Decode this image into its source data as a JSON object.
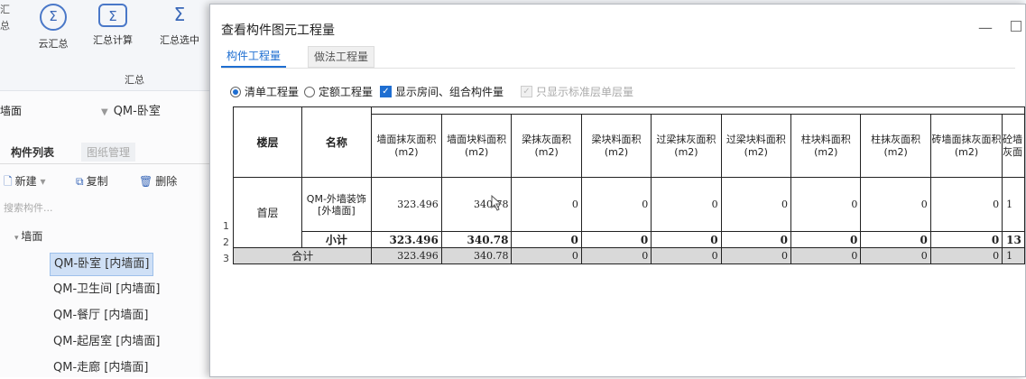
{
  "app": {
    "ribbon_left_partial": [
      "汇",
      "总"
    ],
    "buttons": [
      {
        "label": "云汇总",
        "icon": "Σ"
      },
      {
        "label": "汇总计算",
        "icon": "Σ"
      },
      {
        "label": "汇总选中",
        "icon": "Σ"
      }
    ],
    "group_label": "汇总",
    "selector_left": "墙面",
    "selector_value": "QM-卧室",
    "panel_tabs": [
      "构件列表",
      "图纸管理"
    ],
    "toolbar": {
      "new": "新建",
      "copy": "复制",
      "delete": "删除"
    },
    "search_placeholder": "搜索构件...",
    "tree_root": "墙面",
    "tree_items": [
      {
        "label": "QM-卧室 [内墙面]",
        "selected": true
      },
      {
        "label": "QM-卫生间 [内墙面]",
        "selected": false
      },
      {
        "label": "QM-餐厅 [内墙面]",
        "selected": false
      },
      {
        "label": "QM-起居室 [内墙面]",
        "selected": false
      },
      {
        "label": "QM-走廊 [内墙面]",
        "selected": false
      }
    ]
  },
  "dialog": {
    "title": "查看构件图元工程量",
    "minimize": "—",
    "tabs": [
      {
        "label": "构件工程量",
        "active": true
      },
      {
        "label": "做法工程量",
        "active": false
      }
    ],
    "options": {
      "radio_qd": {
        "label": "清单工程量",
        "checked": true
      },
      "radio_de": {
        "label": "定额工程量",
        "checked": false
      },
      "check_rooms": {
        "label": "显示房间、组合构件量",
        "checked": true
      },
      "check_std": {
        "label": "只显示标准层单层量",
        "checked": true,
        "disabled": true
      }
    },
    "table": {
      "headers": {
        "floor": "楼层",
        "name": "名称",
        "columns": [
          "墙面抹灰面积(m2)",
          "墙面块料面积(m2)",
          "梁抹灰面积(m2)",
          "梁块料面积(m2)",
          "过梁抹灰面积(m2)",
          "过梁块料面积(m2)",
          "柱块料面积(m2)",
          "柱抹灰面积(m2)",
          "砖墙面抹灰面积(m2)",
          "砼墙灰面"
        ]
      },
      "rows": [
        {
          "rownum": "1",
          "floor": "首层",
          "name": "QM-外墙装饰 [外墙面]",
          "values": [
            "323.496",
            "340.78",
            "0",
            "0",
            "0",
            "0",
            "0",
            "0",
            "0",
            "1"
          ]
        },
        {
          "rownum": "2",
          "name": "小计",
          "values": [
            "323.496",
            "340.78",
            "0",
            "0",
            "0",
            "0",
            "0",
            "0",
            "0",
            "13"
          ]
        },
        {
          "rownum": "3",
          "name": "合计",
          "values": [
            "323.496",
            "340.78",
            "0",
            "0",
            "0",
            "0",
            "0",
            "0",
            "0",
            "1"
          ]
        }
      ]
    }
  }
}
